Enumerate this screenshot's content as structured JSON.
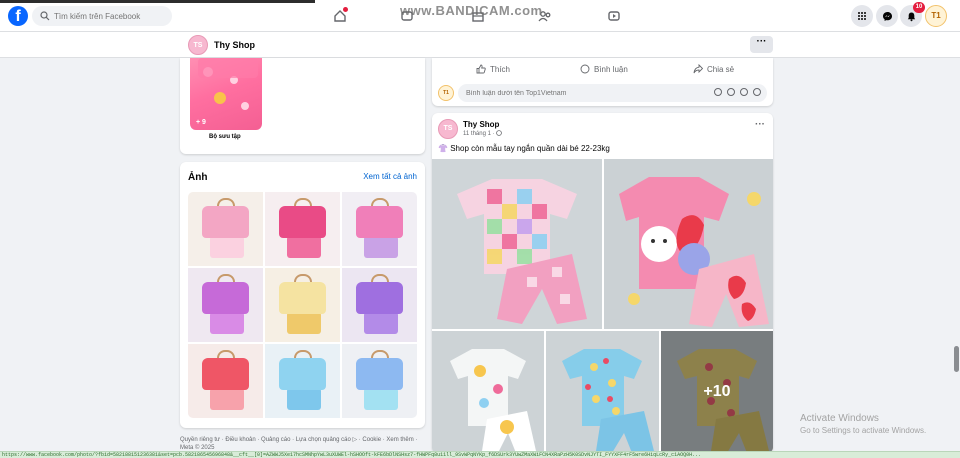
{
  "topbar": {
    "logo_letter": "f",
    "search_placeholder": "Tìm kiếm trên Facebook",
    "notification_count": "10",
    "account_initials": "T1",
    "recording_watermark": "www.BANDICAM.com"
  },
  "page": {
    "name": "Thy Shop",
    "avatar_text": "TS",
    "more_label": "···"
  },
  "collection": {
    "count": "+ 9",
    "label": "Bộ sưu tập"
  },
  "photos": {
    "title": "Ảnh",
    "see_all": "Xem tất cả ảnh",
    "tiles": [
      {
        "bg": "#f5efe9",
        "top": "#f3a6c4",
        "bottom": "#fbd1e0"
      },
      {
        "bg": "#f6eef0",
        "top": "#e94b86",
        "bottom": "#f06fa0"
      },
      {
        "bg": "#f1eef4",
        "top": "#f07fb9",
        "bottom": "#c9a2e6"
      },
      {
        "bg": "#efe8f1",
        "top": "#c66ad8",
        "bottom": "#d98be6"
      },
      {
        "bg": "#f6efe4",
        "top": "#f5e3a1",
        "bottom": "#efc96a"
      },
      {
        "bg": "#ece6f2",
        "top": "#9f6fe0",
        "bottom": "#b38be8"
      },
      {
        "bg": "#f6ebe9",
        "top": "#ef5666",
        "bottom": "#f7a2ab"
      },
      {
        "bg": "#e9f1f6",
        "top": "#8fd3f0",
        "bottom": "#7ec7ec"
      },
      {
        "bg": "#eef0f4",
        "top": "#8db9f1",
        "bottom": "#a3e1f2"
      }
    ]
  },
  "footer": {
    "links": "Quyền riêng tư · Điều khoản · Quảng cáo · Lựa chọn quảng cáo ▷ · Cookie · Xem thêm · Meta © 2025"
  },
  "feed": {
    "like_label": "Thích",
    "comment_label": "Bình luận",
    "share_label": "Chia sẻ",
    "comment_placeholder": "Bình luận dưới tên Top1Vietnam",
    "commenter_initials": "T1"
  },
  "post": {
    "author": "Thy Shop",
    "author_initials": "TS",
    "time": "11 tháng 1 · ",
    "text": "Shop còn mẫu tay ngắn quần dài bé 22-23kg",
    "more_label": "···",
    "extra_photos": "+10"
  },
  "system": {
    "activate_title": "Activate Windows",
    "activate_sub": "Go to Settings to activate Windows.",
    "status_url": "https://www.facebook.com/photo/?fbid=582188151236381&set=pcb.582186545696848&__cft__[0]=AZWWJ5Xe17hcSMNhpYwL3uXUWEl-hSHOOft-kFE6bDlNSHsz7-fHWPFq8u11ll_9SvWPqNYKp_f6DSUrk3YUwZMaXWiFCN4XRaPzH5K0SDvNJYTI_FYYXFF4rF5wre6HiqLcRy_c1AOQ0H..."
  },
  "colors": {
    "brand": "#0866ff",
    "link": "#0064d1",
    "badge": "#e41e3f"
  }
}
